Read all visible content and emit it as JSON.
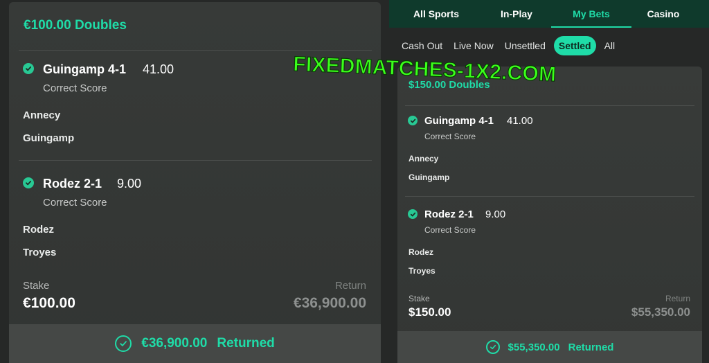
{
  "left_bet": {
    "title": "€100.00 Doubles",
    "selections": [
      {
        "name": "Guingamp 4-1",
        "odds": "41.00",
        "market": "Correct Score",
        "team_home": "Annecy",
        "team_away": "Guingamp"
      },
      {
        "name": "Rodez 2-1",
        "odds": "9.00",
        "market": "Correct Score",
        "team_home": "Rodez",
        "team_away": "Troyes"
      }
    ],
    "stake_label": "Stake",
    "stake_value": "€100.00",
    "return_label": "Return",
    "return_value": "€36,900.00",
    "returned_amount": "€36,900.00",
    "returned_text": "Returned"
  },
  "nav": {
    "tabs": [
      {
        "label": "All Sports"
      },
      {
        "label": "In-Play"
      },
      {
        "label": "My Bets",
        "active": true
      },
      {
        "label": "Casino"
      }
    ]
  },
  "filters": [
    {
      "label": "Cash Out"
    },
    {
      "label": "Live Now"
    },
    {
      "label": "Unsettled"
    },
    {
      "label": "Settled",
      "active": true
    },
    {
      "label": "All"
    }
  ],
  "right_bet": {
    "title": "$150.00 Doubles",
    "selections": [
      {
        "name": "Guingamp 4-1",
        "odds": "41.00",
        "market": "Correct Score",
        "team_home": "Annecy",
        "team_away": "Guingamp"
      },
      {
        "name": "Rodez 2-1",
        "odds": "9.00",
        "market": "Correct Score",
        "team_home": "Rodez",
        "team_away": "Troyes"
      }
    ],
    "stake_label": "Stake",
    "stake_value": "$150.00",
    "return_label": "Return",
    "return_value": "$55,350.00",
    "returned_amount": "$55,350.00",
    "returned_text": "Returned"
  },
  "watermark": "FIXEDMATCHES-1X2.COM",
  "colors": {
    "accent": "#1fdca8",
    "nav_bg": "#0f3a2c",
    "check": "#28c994"
  }
}
